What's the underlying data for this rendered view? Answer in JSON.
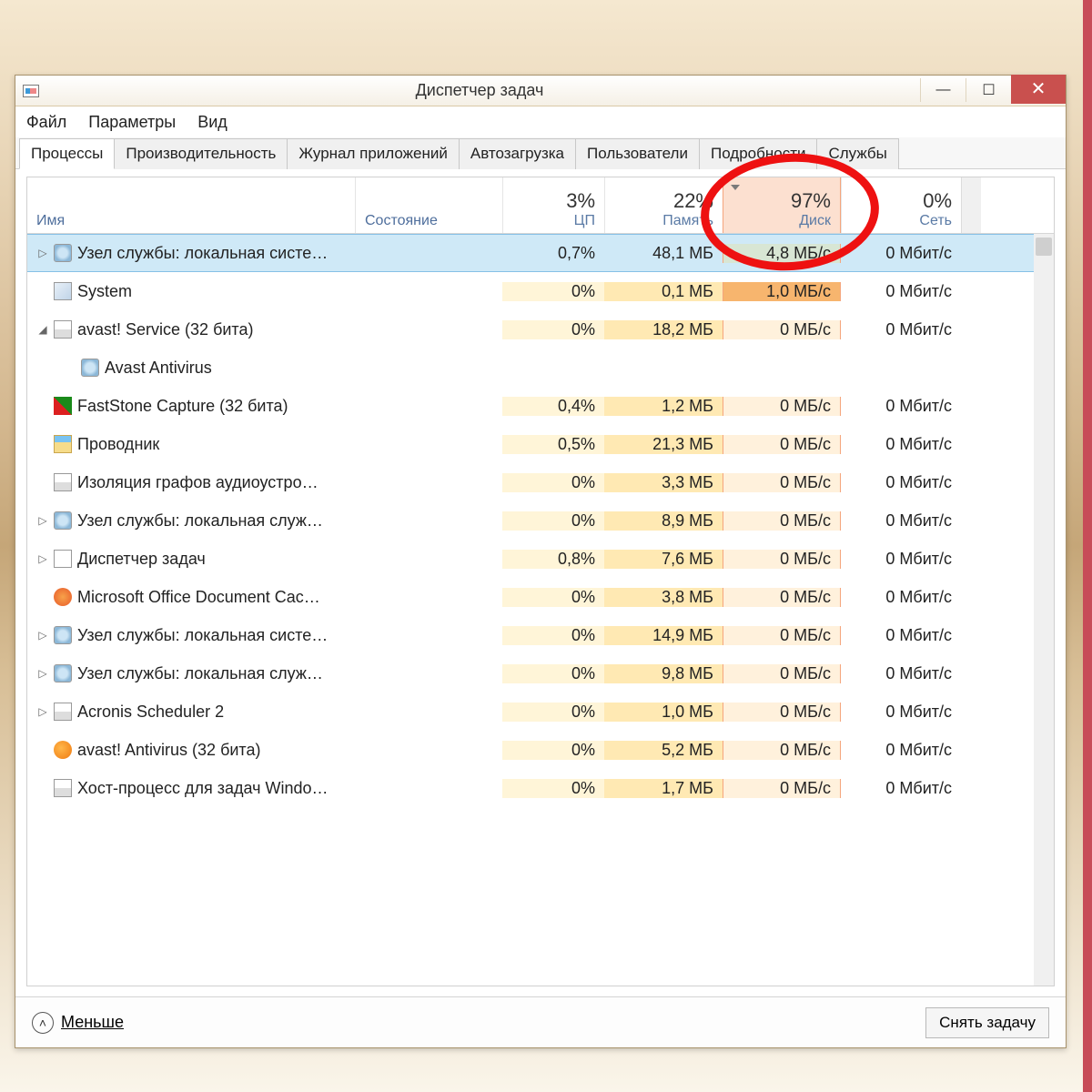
{
  "window": {
    "title": "Диспетчер задач"
  },
  "menu": {
    "file": "Файл",
    "options": "Параметры",
    "view": "Вид"
  },
  "tabs": {
    "processes": "Процессы",
    "performance": "Производительность",
    "apphistory": "Журнал приложений",
    "startup": "Автозагрузка",
    "users": "Пользователи",
    "details": "Подробности",
    "services": "Службы"
  },
  "columns": {
    "name": "Имя",
    "status": "Состояние",
    "cpu_pct": "3%",
    "cpu_label": "ЦП",
    "mem_pct": "22%",
    "mem_label": "Память",
    "disk_pct": "97%",
    "disk_label": "Диск",
    "net_pct": "0%",
    "net_label": "Сеть"
  },
  "rows": [
    {
      "exp": "▷",
      "icon": "gear",
      "name": "Узел службы: локальная систе…",
      "cpu": "0,7%",
      "mem": "48,1 МБ",
      "disk": "4,8 МБ/с",
      "net": "0 Мбит/с",
      "selected": true
    },
    {
      "exp": "",
      "icon": "sys",
      "name": "System",
      "cpu": "0%",
      "mem": "0,1 МБ",
      "disk": "1,0 МБ/с",
      "diskhot": true,
      "net": "0 Мбит/с"
    },
    {
      "exp": "◢",
      "icon": "win",
      "name": "avast! Service (32 бита)",
      "cpu": "0%",
      "mem": "18,2 МБ",
      "disk": "0 МБ/с",
      "net": "0 Мбит/с"
    },
    {
      "exp": "",
      "icon": "gear",
      "name": "Avast Antivirus",
      "indent": true,
      "cpu": "",
      "mem": "",
      "disk": "",
      "net": ""
    },
    {
      "exp": "",
      "icon": "faststone",
      "name": "FastStone Capture (32 бита)",
      "cpu": "0,4%",
      "mem": "1,2 МБ",
      "disk": "0 МБ/с",
      "net": "0 Мбит/с"
    },
    {
      "exp": "",
      "icon": "explorer",
      "name": "Проводник",
      "cpu": "0,5%",
      "mem": "21,3 МБ",
      "disk": "0 МБ/с",
      "net": "0 Мбит/с"
    },
    {
      "exp": "",
      "icon": "win",
      "name": "Изоляция графов аудиоустро…",
      "cpu": "0%",
      "mem": "3,3 МБ",
      "disk": "0 МБ/с",
      "net": "0 Мбит/с"
    },
    {
      "exp": "▷",
      "icon": "gear",
      "name": "Узел службы: локальная служ…",
      "cpu": "0%",
      "mem": "8,9 МБ",
      "disk": "0 МБ/с",
      "net": "0 Мбит/с"
    },
    {
      "exp": "▷",
      "icon": "task",
      "name": "Диспетчер задач",
      "cpu": "0,8%",
      "mem": "7,6 МБ",
      "disk": "0 МБ/с",
      "net": "0 Мбит/с"
    },
    {
      "exp": "",
      "icon": "office",
      "name": "Microsoft Office Document Cac…",
      "cpu": "0%",
      "mem": "3,8 МБ",
      "disk": "0 МБ/с",
      "net": "0 Мбит/с"
    },
    {
      "exp": "▷",
      "icon": "gear",
      "name": "Узел службы: локальная систе…",
      "cpu": "0%",
      "mem": "14,9 МБ",
      "disk": "0 МБ/с",
      "net": "0 Мбит/с"
    },
    {
      "exp": "▷",
      "icon": "gear",
      "name": "Узел службы: локальная служ…",
      "cpu": "0%",
      "mem": "9,8 МБ",
      "disk": "0 МБ/с",
      "net": "0 Мбит/с"
    },
    {
      "exp": "▷",
      "icon": "win",
      "name": "Acronis Scheduler 2",
      "cpu": "0%",
      "mem": "1,0 МБ",
      "disk": "0 МБ/с",
      "net": "0 Мбит/с"
    },
    {
      "exp": "",
      "icon": "avast",
      "name": "avast! Antivirus (32 бита)",
      "cpu": "0%",
      "mem": "5,2 МБ",
      "disk": "0 МБ/с",
      "net": "0 Мбит/с"
    },
    {
      "exp": "",
      "icon": "win",
      "name": "Хост-процесс для задач Windo…",
      "cpu": "0%",
      "mem": "1,7 МБ",
      "disk": "0 МБ/с",
      "net": "0 Мбит/с"
    }
  ],
  "footer": {
    "less": "Меньше",
    "endtask": "Снять задачу"
  }
}
